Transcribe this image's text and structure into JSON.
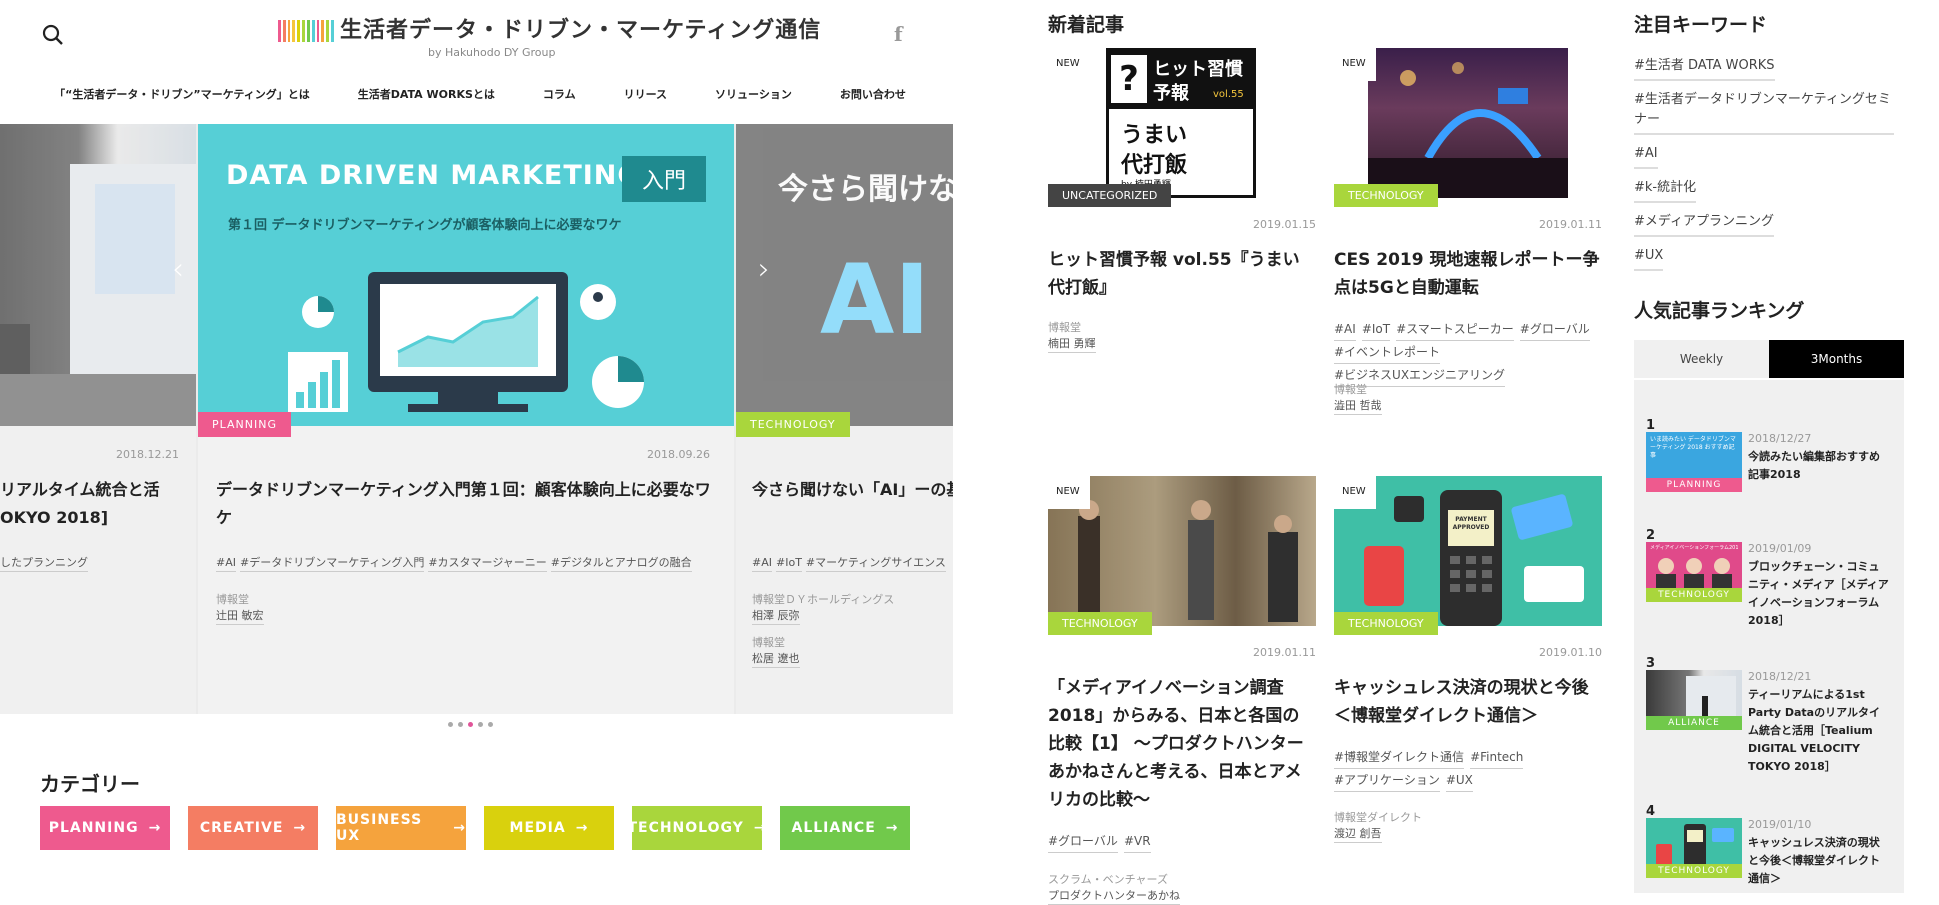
{
  "header": {
    "logo_title": "生活者データ・ドリブン・マーケティング通信",
    "logo_sub": "by Hakuhodo DY Group",
    "facebook_icon": "f",
    "nav": [
      "「“生活者データ・ドリブン”マーケティング」とは",
      "生活者DATA WORKSとは",
      "コラム",
      "リリース",
      "ソリューション",
      "お問い合わせ"
    ]
  },
  "carousel": {
    "prev": {
      "date": "2018.12.21",
      "title": "リアルタイム統合と活 OKYO 2018]",
      "tag": "したプランニング"
    },
    "main": {
      "banner_title": "DATA DRIVEN MARKETING",
      "banner_badge": "入門",
      "banner_sub": "第１回 データドリブンマーケティングが顧客体験向上に必要なワケ",
      "badge": "PLANNING",
      "date": "2018.09.26",
      "title": "データドリブンマーケティング入門第１回：顧客体験向上に必要なワケ",
      "tags": [
        "#AI",
        "#データドリブンマーケティング入門",
        "#カスタマージャーニー",
        "#デジタルとアナログの融合"
      ],
      "org": "博報堂",
      "author": "辻田 敏宏"
    },
    "next": {
      "banner_title": "今さら聞けな",
      "banner_ai": "AI",
      "badge": "TECHNOLOGY",
      "title": "今さら聞けない「AI」ーの基礎知識",
      "tags": [
        "#AI",
        "#IoT",
        "#マーケティングサイエンス"
      ],
      "org1": "博報堂ＤＹホールディングス",
      "author1": "相澤 辰弥",
      "org2": "博報堂",
      "author2": "松居 遼也"
    }
  },
  "categories": {
    "title": "カテゴリー",
    "items": [
      {
        "label": "PLANNING",
        "color": "#ee5a8e"
      },
      {
        "label": "CREATIVE",
        "color": "#f47d63"
      },
      {
        "label": "BUSINESS UX",
        "color": "#f5a33d"
      },
      {
        "label": "MEDIA",
        "color": "#d9d10d"
      },
      {
        "label": "TECHNOLOGY",
        "color": "#a9d63c"
      },
      {
        "label": "ALLIANCE",
        "color": "#71c94b"
      }
    ],
    "arrow": "→"
  },
  "new_articles": {
    "title": "新着記事",
    "new_label": "NEW",
    "cards": [
      {
        "badge": "UNCATEGORIZED",
        "date": "2019.01.15",
        "title": "ヒット習慣予報 vol.55『うまい代打飯』",
        "tags": [],
        "org": "博報堂",
        "author": "楠田 勇輝",
        "thumb_text1": "ヒット習慣",
        "thumb_text2": "予報",
        "thumb_text3": "うまい",
        "thumb_text4": "代打飯",
        "thumb_vol": "vol.55",
        "thumb_by": "by 楠田勇輝"
      },
      {
        "badge": "TECHNOLOGY",
        "date": "2019.01.11",
        "title": "CES 2019 現地速報レポートー争点は5Gと自動運転",
        "tags": [
          "#AI",
          "#IoT",
          "#スマートスピーカー",
          "#グローバル",
          "#イベントレポート",
          "#ビジネスUXエンジニアリング"
        ],
        "org": "博報堂",
        "author": "澁田 哲哉"
      },
      {
        "badge": "TECHNOLOGY",
        "date": "2019.01.11",
        "title": "「メディアイノベーション調査2018」からみる、日本と各国の比較【1】 ～プロダクトハンターあかねさんと考える、日本とアメリカの比較～",
        "tags": [
          "#グローバル",
          "#VR"
        ],
        "org": "スクラム・ベンチャーズ",
        "author": "プロダクトハンターあかね"
      },
      {
        "badge": "TECHNOLOGY",
        "date": "2019.01.10",
        "title": "キャッシュレス決済の現状と今後＜博報堂ダイレクト通信＞",
        "tags": [
          "#博報堂ダイレクト通信",
          "#Fintech",
          "#アプリケーション",
          "#UX"
        ],
        "org": "博報堂ダイレクト",
        "author": "渡辺 創吾",
        "thumb_text": "PAYMENT APPROVED"
      }
    ]
  },
  "keywords": {
    "title": "注目キーワード",
    "items": [
      "#生活者 DATA WORKS",
      "#生活者データドリブンマーケティングセミナー",
      "#AI",
      "#k-統計化",
      "#メディアプランニング",
      "#UX"
    ]
  },
  "ranking": {
    "title": "人気記事ランキング",
    "tabs": [
      "Weekly",
      "3Months"
    ],
    "items": [
      {
        "num": "1",
        "date": "2018/12/27",
        "title": "今読みたい編集部おすすめ記事2018",
        "badge": "PLANNING",
        "color": "#ee5a8e",
        "thumb_text": "いま読みたい データドリブンマーケティング 2018 おすすめ記事"
      },
      {
        "num": "2",
        "date": "2019/01/09",
        "title": "ブロックチェーン・コミュニティ・メディア［メディアイノベーションフォーラム2018］",
        "badge": "TECHNOLOGY",
        "color": "#a9d63c",
        "thumb_text": "メディアイノベーションフォーラム2018"
      },
      {
        "num": "3",
        "date": "2018/12/21",
        "title": "ティーリアムによる1st Party Dataのリアルタイム統合と活用［Tealium DIGITAL VELOCITY TOKYO 2018］",
        "badge": "ALLIANCE",
        "color": "#71c94b"
      },
      {
        "num": "4",
        "date": "2019/01/10",
        "title": "キャッシュレス決済の現状と今後＜博報堂ダイレクト通信＞",
        "badge": "TECHNOLOGY",
        "color": "#a9d63c"
      }
    ]
  },
  "colors": {
    "planning": "#ee5a8e",
    "technology": "#a9d63c",
    "uncategorized": "#444444",
    "banner_cyan": "#56cfd6"
  }
}
